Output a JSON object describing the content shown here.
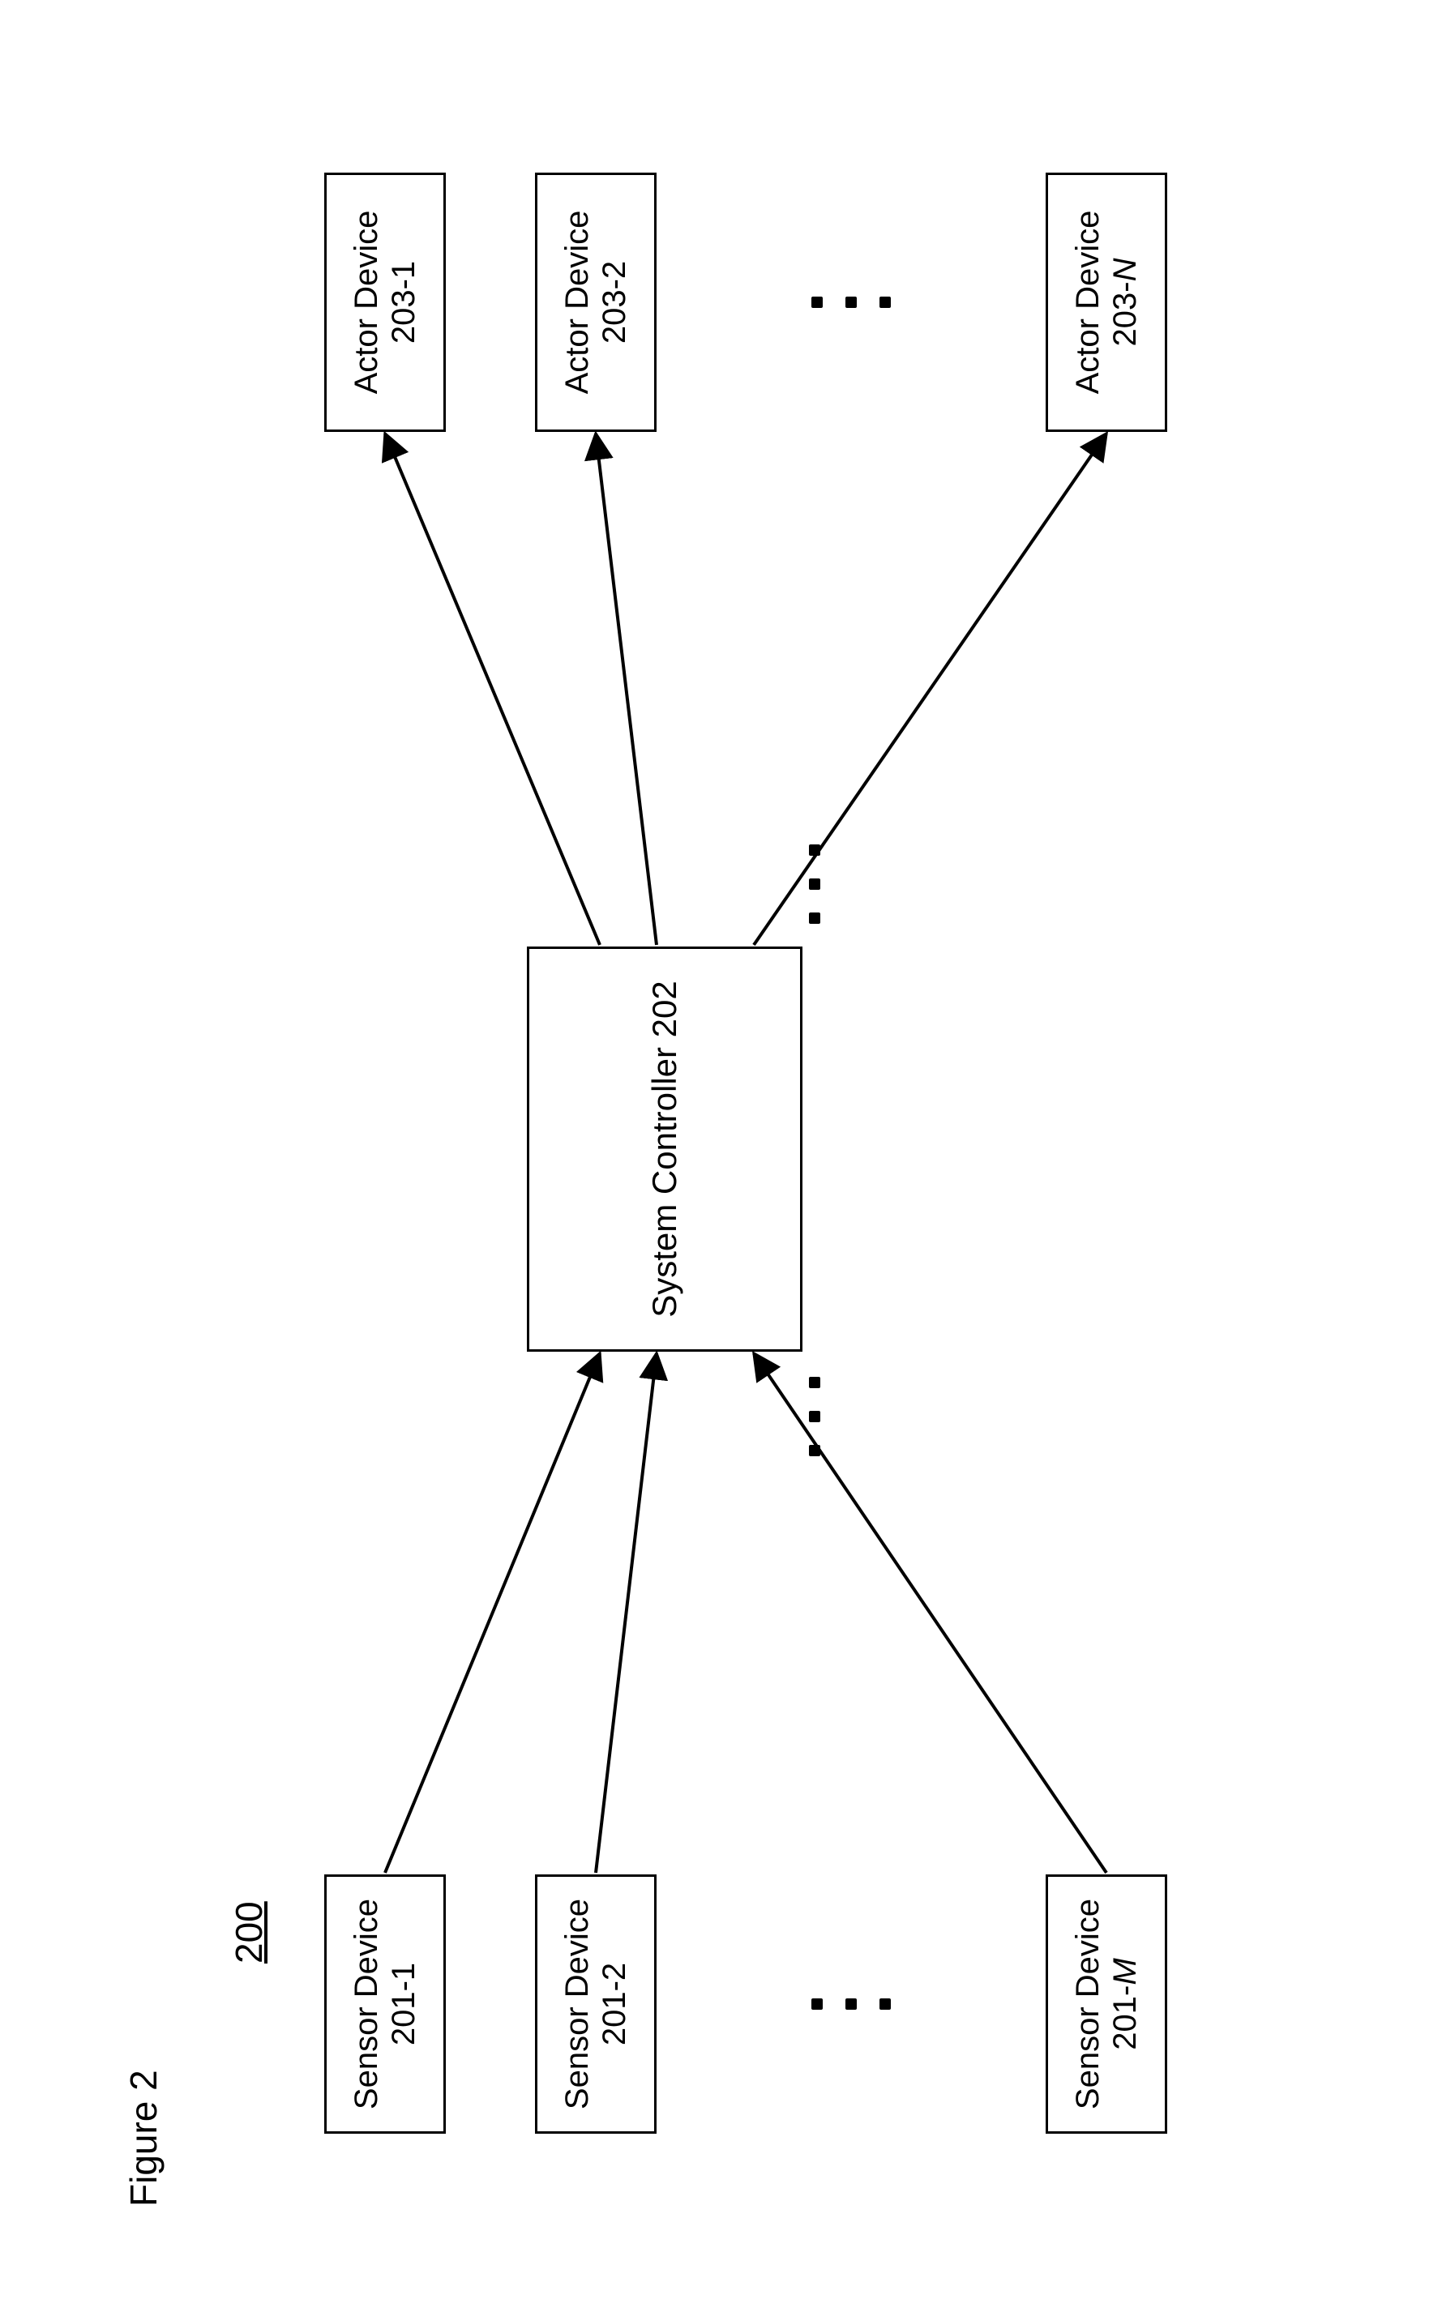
{
  "figure": {
    "title": "Figure 2",
    "refnum": "200"
  },
  "controller": {
    "label": "System Controller 202"
  },
  "sensors": [
    {
      "name": "Sensor Device",
      "id": "201-1",
      "id_ital": ""
    },
    {
      "name": "Sensor Device",
      "id": "201-2",
      "id_ital": ""
    },
    {
      "name": "Sensor Device",
      "id": "201-",
      "id_ital": "M"
    }
  ],
  "actors": [
    {
      "name": "Actor Device",
      "id": "203-1",
      "id_ital": ""
    },
    {
      "name": "Actor Device",
      "id": "203-2",
      "id_ital": ""
    },
    {
      "name": "Actor Device",
      "id": "203-",
      "id_ital": "N"
    }
  ]
}
